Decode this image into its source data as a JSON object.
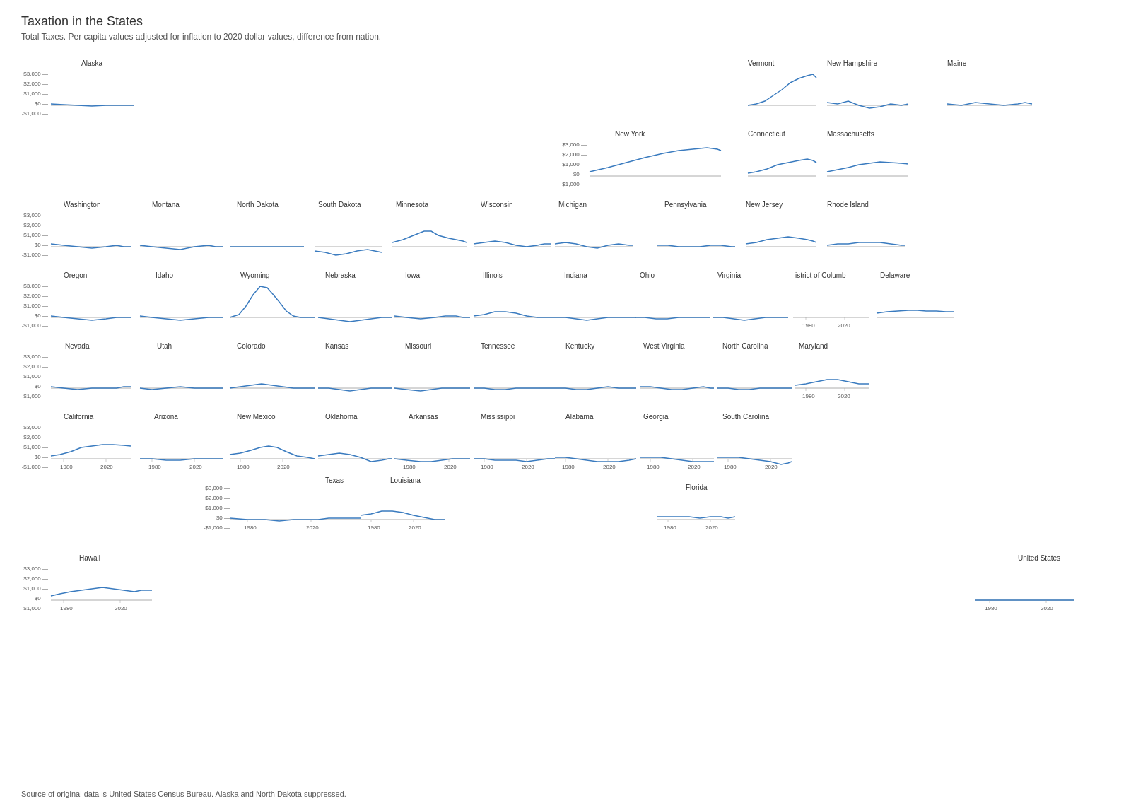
{
  "title": "Taxation in the States",
  "subtitle": "Total Taxes. Per capita values adjusted for inflation to 2020 dollar values, difference from nation.",
  "footer": "Source of original data is United States Census Bureau. Alaska and North Dakota suppressed.",
  "yAxisLabels": [
    "$3,000",
    "$2,000",
    "$1,000",
    "$0",
    "-$1,000"
  ],
  "states": {
    "alaska": "Alaska",
    "vermont": "Vermont",
    "newHampshire": "New Hampshire",
    "maine": "Maine",
    "newYork": "New York",
    "connecticut": "Connecticut",
    "massachusetts": "Massachusetts",
    "washington": "Washington",
    "montana": "Montana",
    "northDakota": "North Dakota",
    "southDakota": "South Dakota",
    "minnesota": "Minnesota",
    "wisconsin": "Wisconsin",
    "michigan": "Michigan",
    "pennsylvania": "Pennsylvania",
    "newJersey": "New Jersey",
    "rhodeIsland": "Rhode Island",
    "oregon": "Oregon",
    "idaho": "Idaho",
    "wyoming": "Wyoming",
    "nebraska": "Nebraska",
    "iowa": "Iowa",
    "illinois": "Illinois",
    "indiana": "Indiana",
    "ohio": "Ohio",
    "virginia": "Virginia",
    "districtOfColumbia": "istrict of Columb",
    "delaware": "Delaware",
    "nevada": "Nevada",
    "utah": "Utah",
    "colorado": "Colorado",
    "kansas": "Kansas",
    "missouri": "Missouri",
    "tennessee": "Tennessee",
    "kentucky": "Kentucky",
    "westVirginia": "West Virginia",
    "northCarolina": "North Carolina",
    "maryland": "Maryland",
    "california": "California",
    "arizona": "Arizona",
    "newMexico": "New Mexico",
    "oklahoma": "Oklahoma",
    "arkansas": "Arkansas",
    "mississippi": "Mississippi",
    "alabama": "Alabama",
    "georgia": "Georgia",
    "southCarolina": "South Carolina",
    "texas": "Texas",
    "louisiana": "Louisiana",
    "florida": "Florida",
    "hawaii": "Hawaii",
    "unitedStates": "United States"
  },
  "xAxisLabels": {
    "start": "1980",
    "end": "2020"
  }
}
